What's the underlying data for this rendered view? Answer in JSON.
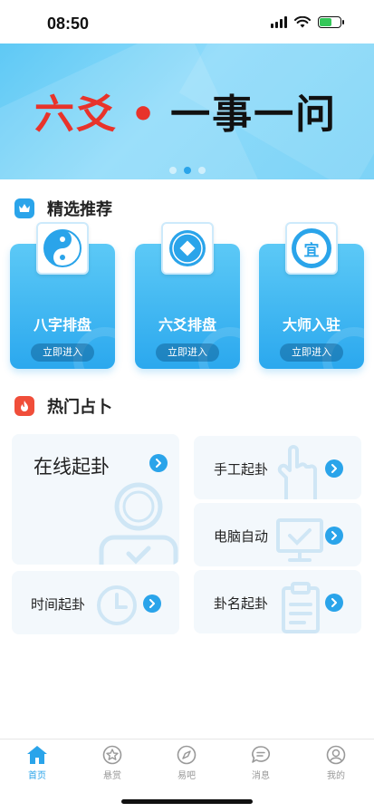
{
  "status_bar": {
    "time": "08:50"
  },
  "banner": {
    "title_red": "六爻",
    "title_dot": "•",
    "title_black": "一事一问",
    "page_count": 3,
    "active_page": 2
  },
  "featured": {
    "title": "精选推荐",
    "icon": "crown-icon",
    "cards": [
      {
        "label": "八字排盘",
        "button": "立即进入",
        "icon": "yin-yang-icon"
      },
      {
        "label": "六爻排盘",
        "button": "立即进入",
        "icon": "coin-icon"
      },
      {
        "label": "大师入驻",
        "button": "立即进入",
        "icon": "seal-yi-icon",
        "icon_text": "宜"
      }
    ]
  },
  "hot": {
    "title": "热门占卜",
    "icon": "fire-icon",
    "tiles": {
      "online": "在线起卦",
      "time": "时间起卦",
      "manual": "手工起卦",
      "computer": "电脑自动",
      "name": "卦名起卦"
    }
  },
  "tabbar": {
    "tabs": [
      {
        "label": "首页",
        "icon": "home-icon",
        "active": true
      },
      {
        "label": "悬赏",
        "icon": "star-icon",
        "active": false
      },
      {
        "label": "易吧",
        "icon": "compass-icon",
        "active": false
      },
      {
        "label": "消息",
        "icon": "message-icon",
        "active": false
      },
      {
        "label": "我的",
        "icon": "user-icon",
        "active": false
      }
    ]
  },
  "colors": {
    "accent": "#2aa4ea",
    "banner_red": "#e8332b",
    "tile_bg": "#f3f8fc",
    "fire": "#f04e3a"
  }
}
